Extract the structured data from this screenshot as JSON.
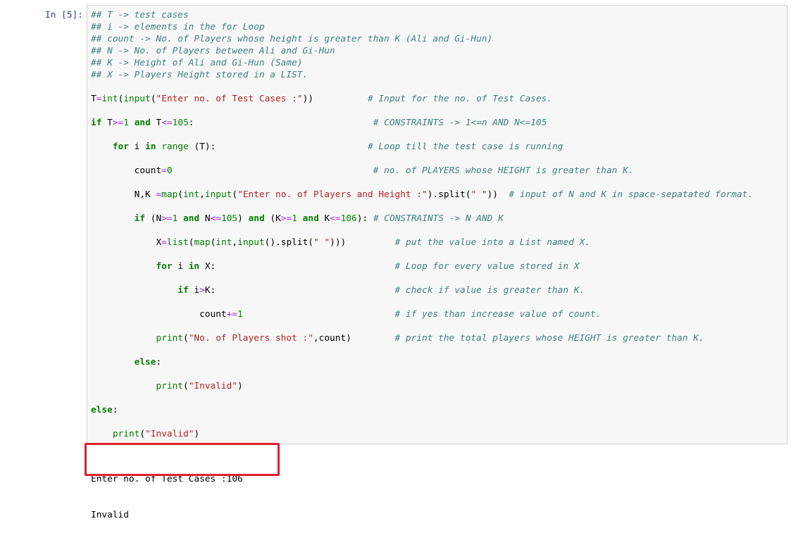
{
  "cell": {
    "prompt": "In [5]:",
    "code_lines": [
      [
        [
          "cm",
          "## T -> test cases"
        ]
      ],
      [
        [
          "cm",
          "## i -> elements in the for Loop"
        ]
      ],
      [
        [
          "cm",
          "## count -> No. of Players whose height is greater than K (Ali and Gi-Hun)"
        ]
      ],
      [
        [
          "cm",
          "## N -> No. of Players between Ali and Gi-Hun"
        ]
      ],
      [
        [
          "cm",
          "## K -> Height of Ali and Gi-Hun (Same)"
        ]
      ],
      [
        [
          "cm",
          "## X -> Players Height stored in a LIST."
        ]
      ],
      [],
      [
        [
          "n",
          "T"
        ],
        [
          "op",
          "="
        ],
        [
          "bi",
          "int"
        ],
        [
          "n",
          "("
        ],
        [
          "bi",
          "input"
        ],
        [
          "n",
          "("
        ],
        [
          "str",
          "\"Enter no. of Test Cases :\""
        ],
        [
          "n",
          "))          "
        ],
        [
          "cm",
          "# Input for the no. of Test Cases."
        ]
      ],
      [],
      [
        [
          "kw",
          "if"
        ],
        [
          "n",
          " T"
        ],
        [
          "op",
          ">="
        ],
        [
          "num",
          "1"
        ],
        [
          "n",
          " "
        ],
        [
          "kw",
          "and"
        ],
        [
          "n",
          " T"
        ],
        [
          "op",
          "<="
        ],
        [
          "num",
          "105"
        ],
        [
          "n",
          ":                                 "
        ],
        [
          "cm",
          "# CONSTRAINTS -> 1<=n AND N<=105"
        ]
      ],
      [],
      [
        [
          "n",
          "    "
        ],
        [
          "kw",
          "for"
        ],
        [
          "n",
          " i "
        ],
        [
          "kw",
          "in"
        ],
        [
          "n",
          " "
        ],
        [
          "bi",
          "range"
        ],
        [
          "n",
          " (T):                            "
        ],
        [
          "cm",
          "# Loop till the test case is running"
        ]
      ],
      [],
      [
        [
          "n",
          "        count"
        ],
        [
          "op",
          "="
        ],
        [
          "num",
          "0"
        ],
        [
          "n",
          "                                     "
        ],
        [
          "cm",
          "# no. of PLAYERS whose HEIGHT is greater than K."
        ]
      ],
      [],
      [
        [
          "n",
          "        N,K "
        ],
        [
          "op",
          "="
        ],
        [
          "bi",
          "map"
        ],
        [
          "n",
          "("
        ],
        [
          "bi",
          "int"
        ],
        [
          "n",
          ","
        ],
        [
          "bi",
          "input"
        ],
        [
          "n",
          "("
        ],
        [
          "str",
          "\"Enter no. of Players and Height :\""
        ],
        [
          "n",
          ").split("
        ],
        [
          "str",
          "\" \""
        ],
        [
          "n",
          "))  "
        ],
        [
          "cm",
          "# input of N and K in space-sepatated format."
        ]
      ],
      [],
      [
        [
          "n",
          "        "
        ],
        [
          "kw",
          "if"
        ],
        [
          "n",
          " (N"
        ],
        [
          "op",
          ">="
        ],
        [
          "num",
          "1"
        ],
        [
          "n",
          " "
        ],
        [
          "kw",
          "and"
        ],
        [
          "n",
          " N"
        ],
        [
          "op",
          "<="
        ],
        [
          "num",
          "105"
        ],
        [
          "n",
          ") "
        ],
        [
          "kw",
          "and"
        ],
        [
          "n",
          " (K"
        ],
        [
          "op",
          ">="
        ],
        [
          "num",
          "1"
        ],
        [
          "n",
          " "
        ],
        [
          "kw",
          "and"
        ],
        [
          "n",
          " K"
        ],
        [
          "op",
          "<="
        ],
        [
          "num",
          "106"
        ],
        [
          "n",
          "): "
        ],
        [
          "cm",
          "# CONSTRAINTS -> N AND K"
        ]
      ],
      [],
      [
        [
          "n",
          "            X"
        ],
        [
          "op",
          "="
        ],
        [
          "bi",
          "list"
        ],
        [
          "n",
          "("
        ],
        [
          "bi",
          "map"
        ],
        [
          "n",
          "("
        ],
        [
          "bi",
          "int"
        ],
        [
          "n",
          ","
        ],
        [
          "bi",
          "input"
        ],
        [
          "n",
          "().split("
        ],
        [
          "str",
          "\" \""
        ],
        [
          "n",
          ")))         "
        ],
        [
          "cm",
          "# put the value into a List named X."
        ]
      ],
      [],
      [
        [
          "n",
          "            "
        ],
        [
          "kw",
          "for"
        ],
        [
          "n",
          " i "
        ],
        [
          "kw",
          "in"
        ],
        [
          "n",
          " X:                                 "
        ],
        [
          "cm",
          "# Loop for every value stored in X"
        ]
      ],
      [],
      [
        [
          "n",
          "                "
        ],
        [
          "kw",
          "if"
        ],
        [
          "n",
          " i"
        ],
        [
          "op",
          ">"
        ],
        [
          "n",
          "K:                                 "
        ],
        [
          "cm",
          "# check if value is greater than K."
        ]
      ],
      [],
      [
        [
          "n",
          "                    count"
        ],
        [
          "op",
          "+="
        ],
        [
          "num",
          "1"
        ],
        [
          "n",
          "                            "
        ],
        [
          "cm",
          "# if yes than increase value of count."
        ]
      ],
      [],
      [
        [
          "n",
          "            "
        ],
        [
          "bi",
          "print"
        ],
        [
          "n",
          "("
        ],
        [
          "str",
          "\"No. of Players shot :\""
        ],
        [
          "n",
          ",count)        "
        ],
        [
          "cm",
          "# print the total players whose HEIGHT is greater than K."
        ]
      ],
      [],
      [
        [
          "n",
          "        "
        ],
        [
          "kw",
          "else"
        ],
        [
          "n",
          ":"
        ]
      ],
      [],
      [
        [
          "n",
          "            "
        ],
        [
          "bi",
          "print"
        ],
        [
          "n",
          "("
        ],
        [
          "str",
          "\"Invalid\""
        ],
        [
          "n",
          ")"
        ]
      ],
      [],
      [
        [
          "kw",
          "else"
        ],
        [
          "n",
          ":"
        ]
      ],
      [],
      [
        [
          "n",
          "    "
        ],
        [
          "bi",
          "print"
        ],
        [
          "n",
          "("
        ],
        [
          "str",
          "\"Invalid\""
        ],
        [
          "n",
          ")"
        ]
      ]
    ],
    "output_lines": [
      "Enter no. of Test Cases :106",
      "Invalid"
    ]
  },
  "colors": {
    "keyword": "#008000",
    "operator": "#AA22FF",
    "string": "#BA2121",
    "comment": "#408080",
    "prompt": "#303F9F",
    "highlight_border": "#e0202f"
  }
}
